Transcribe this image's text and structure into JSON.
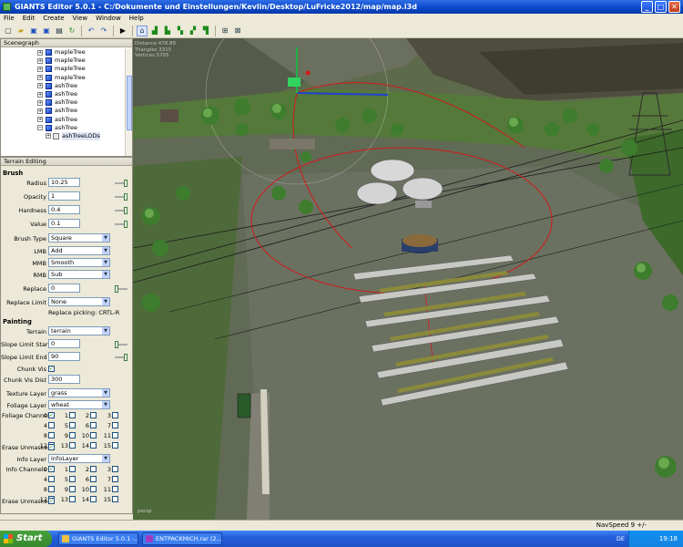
{
  "window": {
    "title": "GIANTS Editor 5.0.1 - C:/Dokumente und Einstellungen/Kevlin/Desktop/LuFricke2012/map/map.i3d",
    "minimize": "_",
    "maximize": "□",
    "close": "✕"
  },
  "menu": [
    "File",
    "Edit",
    "Create",
    "View",
    "Window",
    "Help"
  ],
  "toolbar_icons": [
    "new-icon",
    "open-icon",
    "save-icon",
    "save-all-icon",
    "export-icon",
    "import-icon",
    "undo-icon",
    "redo-icon",
    "play-icon",
    "select-icon",
    "move-icon",
    "rotate-icon",
    "scale-icon",
    "terrain-icon",
    "paint-icon",
    "grid-icon",
    "snap-icon"
  ],
  "scenegraph": {
    "title": "Scenegraph",
    "items": [
      {
        "label": "mapleTree"
      },
      {
        "label": "mapleTree"
      },
      {
        "label": "mapleTree"
      },
      {
        "label": "mapleTree"
      },
      {
        "label": "ashTree"
      },
      {
        "label": "ashTree"
      },
      {
        "label": "ashTree"
      },
      {
        "label": "ashTree"
      },
      {
        "label": "ashTree"
      },
      {
        "label": "ashTree"
      }
    ],
    "subitem": "ashTreeLODs"
  },
  "terrain": {
    "title": "Terrain Editing",
    "brush_section": "Brush",
    "radius_label": "Radius",
    "radius": "10.25",
    "opacity_label": "Opacity",
    "opacity": "1",
    "hardness_label": "Hardness",
    "hardness": "0.4",
    "value_label": "Value",
    "value": "0.1",
    "brush_type_label": "Brush Type",
    "brush_type": "Square",
    "lmb_label": "LMB",
    "lmb": "Add",
    "mmb_label": "MMB",
    "mmb": "Smooth",
    "rmb_label": "RMB",
    "rmb": "Sub",
    "replace_label": "Replace",
    "replace": "0",
    "replace_limit_label": "Replace Limit",
    "replace_limit": "None",
    "replace_hint": "Replace picking: CRTL-R",
    "painting_section": "Painting",
    "terrain_label": "Terrain",
    "terrain_value": "terrain",
    "slope_start_label": "Slope Limit Start",
    "slope_start": "0",
    "slope_end_label": "Slope Limit End",
    "slope_end": "90",
    "chunk_vis_label": "Chunk Vis",
    "chunk_vis_dist_label": "Chunk Vis Dist",
    "chunk_vis_dist": "300",
    "texture_layer_label": "Texture Layer",
    "texture_layer": "grass",
    "foliage_layer_label": "Foliage Layer",
    "foliage_layer": "wheat",
    "foliage_channels_label": "Foliage Channels",
    "erase_unmasked_label": "Erase Unmasked",
    "info_layer_label": "Info Layer",
    "info_layer": "infoLayer",
    "info_channels_label": "Info Channels",
    "erase_unmasked2_label": "Erase Unmasked",
    "channels": [
      "0",
      "1",
      "2",
      "3",
      "4",
      "5",
      "6",
      "7",
      "8",
      "9",
      "10",
      "11",
      "12",
      "13",
      "14",
      "15"
    ]
  },
  "viewport": {
    "stats": [
      "Distance 478.89",
      "Triangles 3315",
      "Vertices 5705"
    ],
    "camera": "persp"
  },
  "status": {
    "navspeed": "NavSpeed 9 +/-"
  },
  "taskbar": {
    "start": "Start",
    "tasks": [
      {
        "label": "GIANTS Editor 5.0.1 -..."
      },
      {
        "label": "ENTPACKMICH.rar (2..."
      }
    ],
    "lang": "DE",
    "clock": "19:18"
  },
  "colors": {
    "title_blue": "#0a47c8",
    "taskbar_blue": "#245edb",
    "start_green": "#37892d"
  }
}
